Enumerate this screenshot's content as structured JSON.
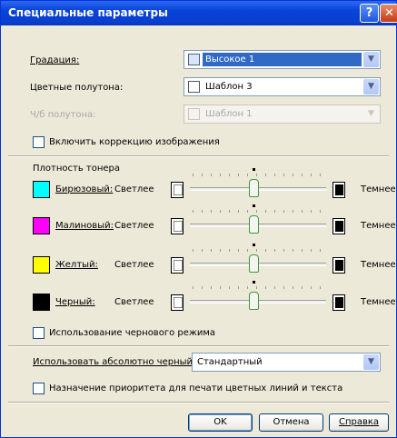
{
  "window": {
    "title": "Специальные параметры",
    "help_glyph": "?",
    "close_glyph": "✕"
  },
  "gradation": {
    "label": "Градация:",
    "value": "Высокое 1"
  },
  "color_halftones": {
    "label": "Цветные полутона:",
    "value": "Шаблон 3"
  },
  "bw_halftones": {
    "label": "Ч/б полутона:",
    "value": "Шаблон 1"
  },
  "image_correction": {
    "label": "Включить коррекцию изображения",
    "checked": false
  },
  "toner": {
    "title": "Плотность тонера",
    "lighter": "Светлее",
    "darker": "Темнее",
    "rows": [
      {
        "name": "Бирюзовый:",
        "color": "#00ffff",
        "level": 0.5
      },
      {
        "name": "Малиновый:",
        "color": "#ff00ff",
        "level": 0.5
      },
      {
        "name": "Желтый:",
        "color": "#ffff00",
        "level": 0.5
      },
      {
        "name": "Черный:",
        "color": "#000000",
        "level": 0.5
      }
    ]
  },
  "black_mode": {
    "label": "Использование черновогo режима",
    "checked": false
  },
  "absolute_black": {
    "label": "Использовать абсолютно черный:",
    "value": "Стандартный"
  },
  "priority": {
    "label": "Назначение приоритета для печати цветных линий и текста",
    "checked": false
  },
  "buttons": {
    "ok": "OK",
    "cancel": "Отмена",
    "help": "Справка"
  }
}
